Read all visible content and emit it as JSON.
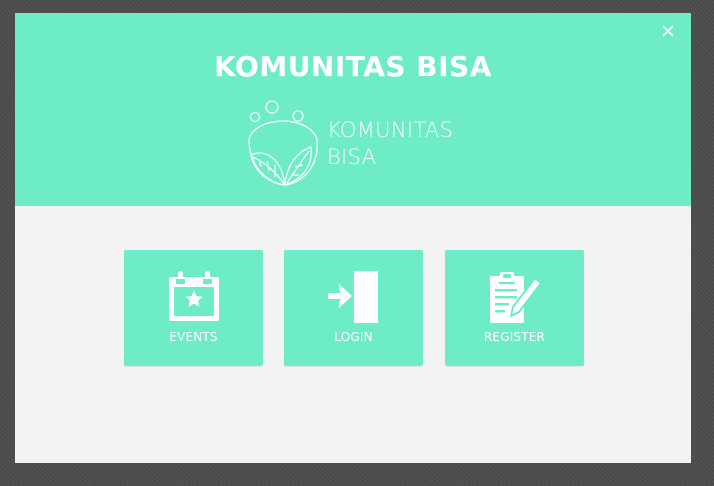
{
  "modal": {
    "title": "KOMUNITAS BISA",
    "close_icon": "close-icon",
    "logo": {
      "line1": "KOMUNITAS",
      "line2": "BISA"
    }
  },
  "tiles": [
    {
      "label": "EVENTS",
      "icon": "calendar-star-icon"
    },
    {
      "label": "LOGIN",
      "icon": "login-door-icon"
    },
    {
      "label": "REGISTER",
      "icon": "clipboard-pen-icon"
    }
  ],
  "colors": {
    "accent": "#6eecc7",
    "body": "#f3f3f3",
    "overlay": "#4a4a4a",
    "text_on_accent": "#ffffff"
  }
}
